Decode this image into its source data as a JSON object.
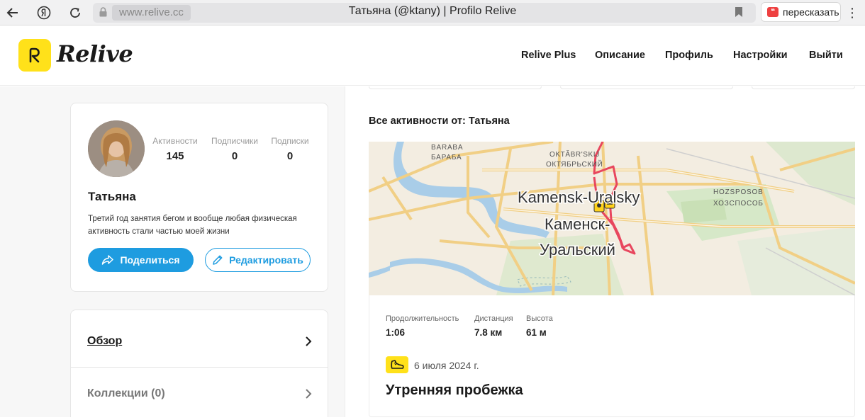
{
  "browser": {
    "url": "www.relive.cc",
    "tab_title": "Татьяна (@ktany) | Profilo Relive",
    "retell_label": "пересказать",
    "menu_glyph": "⋮"
  },
  "header": {
    "logo_text": "Relive",
    "nav": [
      "Relive Plus",
      "Описание",
      "Профиль",
      "Настройки",
      "Выйти"
    ]
  },
  "profile": {
    "stats": [
      {
        "label": "Активности",
        "value": "145"
      },
      {
        "label": "Подписчики",
        "value": "0"
      },
      {
        "label": "Подписки",
        "value": "0"
      }
    ],
    "name": "Татьяна",
    "bio": "Третий год занятия бегом и вообще любая физическая активность стали частью моей жизни",
    "share_label": "Поделиться",
    "edit_label": "Редактировать"
  },
  "sidebar_menu": {
    "overview_label": "Обзор",
    "collections_label": "Коллекции (0)"
  },
  "feed": {
    "title": "Все активности от: Татьяна"
  },
  "activity": {
    "map_labels": {
      "baraba_lat": "BARABA",
      "baraba_cyr": "БАРАБА",
      "oktyabr_lat": "OKTĂBR'SKIJ",
      "oktyabr_cyr": "ОКТЯБРЬСКИЙ",
      "khoz_lat": "HOZSPOSOB",
      "khoz_cyr": "ХОЗСПОСОБ",
      "city_lat": "Kamensk-Uralsky",
      "city_cyr_1": "Каменск-",
      "city_cyr_2": "Уральский"
    },
    "stats": [
      {
        "label": "Продолжительность",
        "value": "1:06"
      },
      {
        "label": "Дистанция",
        "value": "7.8 км"
      },
      {
        "label": "Высота",
        "value": "61 м"
      }
    ],
    "date": "6 июля 2024 г.",
    "title": "Утренняя пробежка"
  },
  "colors": {
    "brand_yellow": "#ffe11a",
    "accent_blue": "#1e9ce0",
    "route_red": "#e8475e",
    "map_bg": "#f3ede1",
    "map_water": "#a9cde8",
    "map_green": "#d6e8c8",
    "map_road": "#f1cf85"
  }
}
